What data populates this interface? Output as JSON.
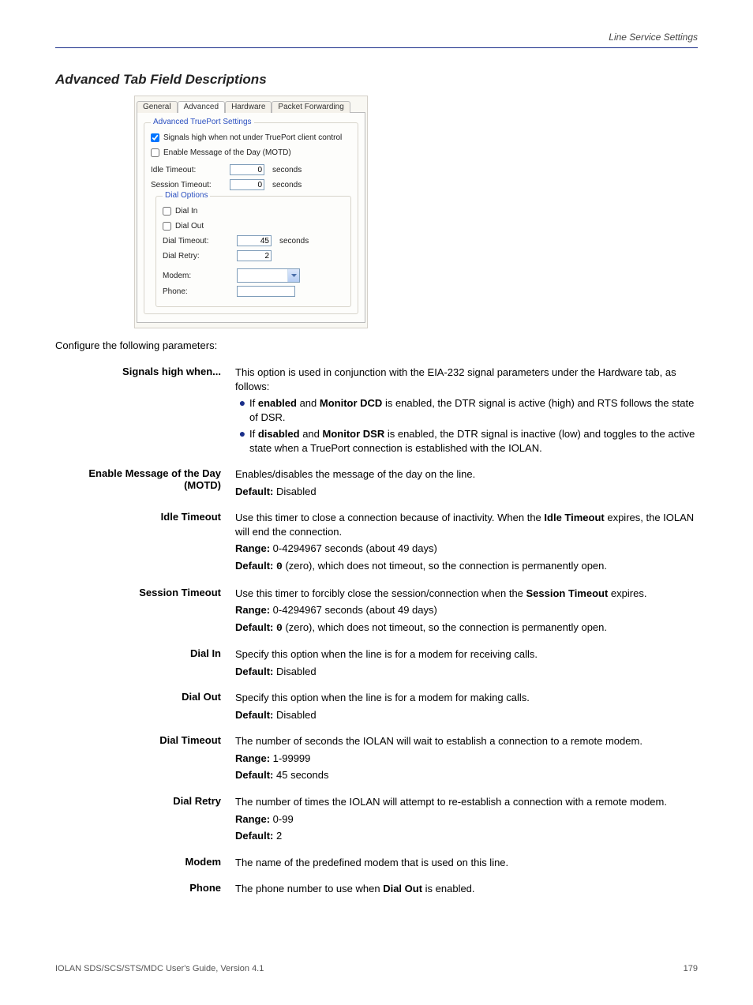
{
  "header": {
    "left": "",
    "right": "Line Service Settings"
  },
  "section_title": "Advanced Tab Field Descriptions",
  "screenshot": {
    "tabs": [
      "General",
      "Advanced",
      "Hardware",
      "Packet Forwarding"
    ],
    "active_tab": 1,
    "group_title": "Advanced TruePort Settings",
    "cb_signals": {
      "checked": true,
      "label": "Signals high when not under TruePort client control"
    },
    "cb_motd": {
      "checked": false,
      "label": "Enable Message of the Day (MOTD)"
    },
    "idle": {
      "label": "Idle Timeout:",
      "value": "0",
      "unit": "seconds"
    },
    "session": {
      "label": "Session Timeout:",
      "value": "0",
      "unit": "seconds"
    },
    "dial": {
      "title": "Dial Options",
      "in": {
        "checked": false,
        "label": "Dial In"
      },
      "out": {
        "checked": false,
        "label": "Dial Out"
      },
      "timeout": {
        "label": "Dial Timeout:",
        "value": "45",
        "unit": "seconds"
      },
      "retry": {
        "label": "Dial Retry:",
        "value": "2"
      },
      "modem": {
        "label": "Modem:",
        "value": ""
      },
      "phone": {
        "label": "Phone:",
        "value": ""
      }
    }
  },
  "rows": [
    {
      "label": "Signals high when...",
      "desc": "This option is used in conjunction with the EIA-232 signal parameters under the Hardware tab, as follows:",
      "subs": [
        "If <b>enabled</b> and <b>Monitor DCD</b> is enabled, the DTR signal is active (high) and RTS follows the state of DSR.",
        "If <b>disabled</b> and <b>Monitor DSR</b> is enabled, the DTR signal is inactive (low) and toggles to the active state when a TruePort connection is established with the IOLAN."
      ]
    },
    {
      "label": "Enable Message of the Day (MOTD)",
      "desc": "Enables/disables the message of the day on the line.",
      "default": "Disabled"
    },
    {
      "label": "Idle Timeout",
      "desc": "Use this timer to close a connection because of inactivity. When the <b>Idle Timeout</b> expires, the IOLAN will end the connection.",
      "range": "0-4294967 seconds (about 49 days)",
      "default": "<code>0</code> (zero), which does not timeout, so the connection is permanently open."
    },
    {
      "label": "Session Timeout",
      "desc": "Use this timer to forcibly close the session/connection when the <b>Session Timeout</b> expires.",
      "range": "0-4294967 seconds (about 49 days)",
      "default": "<code>0</code> (zero), which does not timeout, so the connection is permanently open."
    },
    {
      "label": "Dial In",
      "desc": "Specify this option when the line is for a modem for receiving calls.",
      "default": "Disabled"
    },
    {
      "label": "Dial Out",
      "desc": "Specify this option when the line is for a modem for making calls.",
      "default": "Disabled"
    },
    {
      "label": "Dial Timeout",
      "desc": "The number of seconds the IOLAN will wait to establish a connection to a remote modem.",
      "range": "1-99999",
      "default": "45 seconds"
    },
    {
      "label": "Dial Retry",
      "desc": "The number of times the IOLAN will attempt to re-establish a connection with a remote modem.",
      "range": "0-99",
      "default": "2"
    },
    {
      "label": "Modem",
      "desc": "The name of the predefined modem that is used on this line."
    },
    {
      "label": "Phone",
      "desc": "The phone number to use when <b>Dial Out</b> is enabled."
    }
  ],
  "footer": {
    "left": "IOLAN SDS/SCS/STS/MDC User's Guide, Version 4.1",
    "right": "179"
  },
  "labels": {
    "range": "Range:",
    "default": "Default:"
  }
}
